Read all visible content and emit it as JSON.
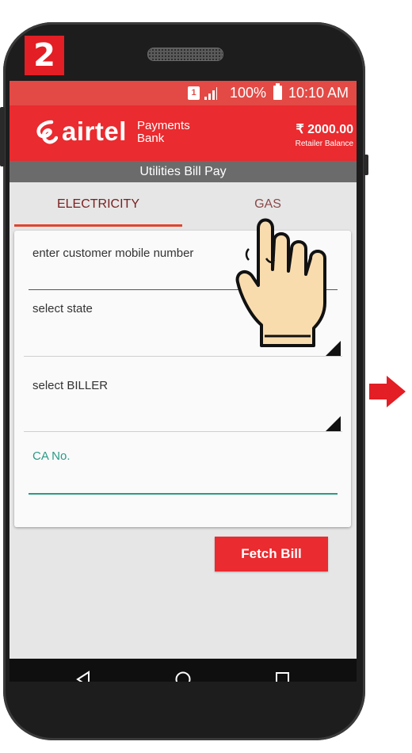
{
  "step": {
    "number": "2"
  },
  "status_bar": {
    "sim": "1",
    "battery": "100%",
    "time": "10:10 AM"
  },
  "app_bar": {
    "brand": "airtel",
    "sub_line1": "Payments",
    "sub_line2": "Bank",
    "balance": "₹ 2000.00",
    "balance_label": "Retailer Balance"
  },
  "page_title": "Utilities Bill Pay",
  "tabs": [
    {
      "label": "ELECTRICITY",
      "selected": true
    },
    {
      "label": "GAS",
      "selected": false
    }
  ],
  "form": {
    "mobile_label": "enter customer mobile number",
    "state_label": "select state",
    "biller_label": "select BILLER",
    "ca_label": "CA No."
  },
  "buttons": {
    "fetch": "Fetch Bill"
  },
  "nav": {
    "back_icon": "back-triangle-icon",
    "home_icon": "home-circle-icon",
    "recents_icon": "recents-square-icon"
  },
  "colors": {
    "brand_red": "#ea2b2f",
    "status_red": "#e34a45",
    "accent_teal": "#2a9a86",
    "badge_red": "#e31e24"
  }
}
